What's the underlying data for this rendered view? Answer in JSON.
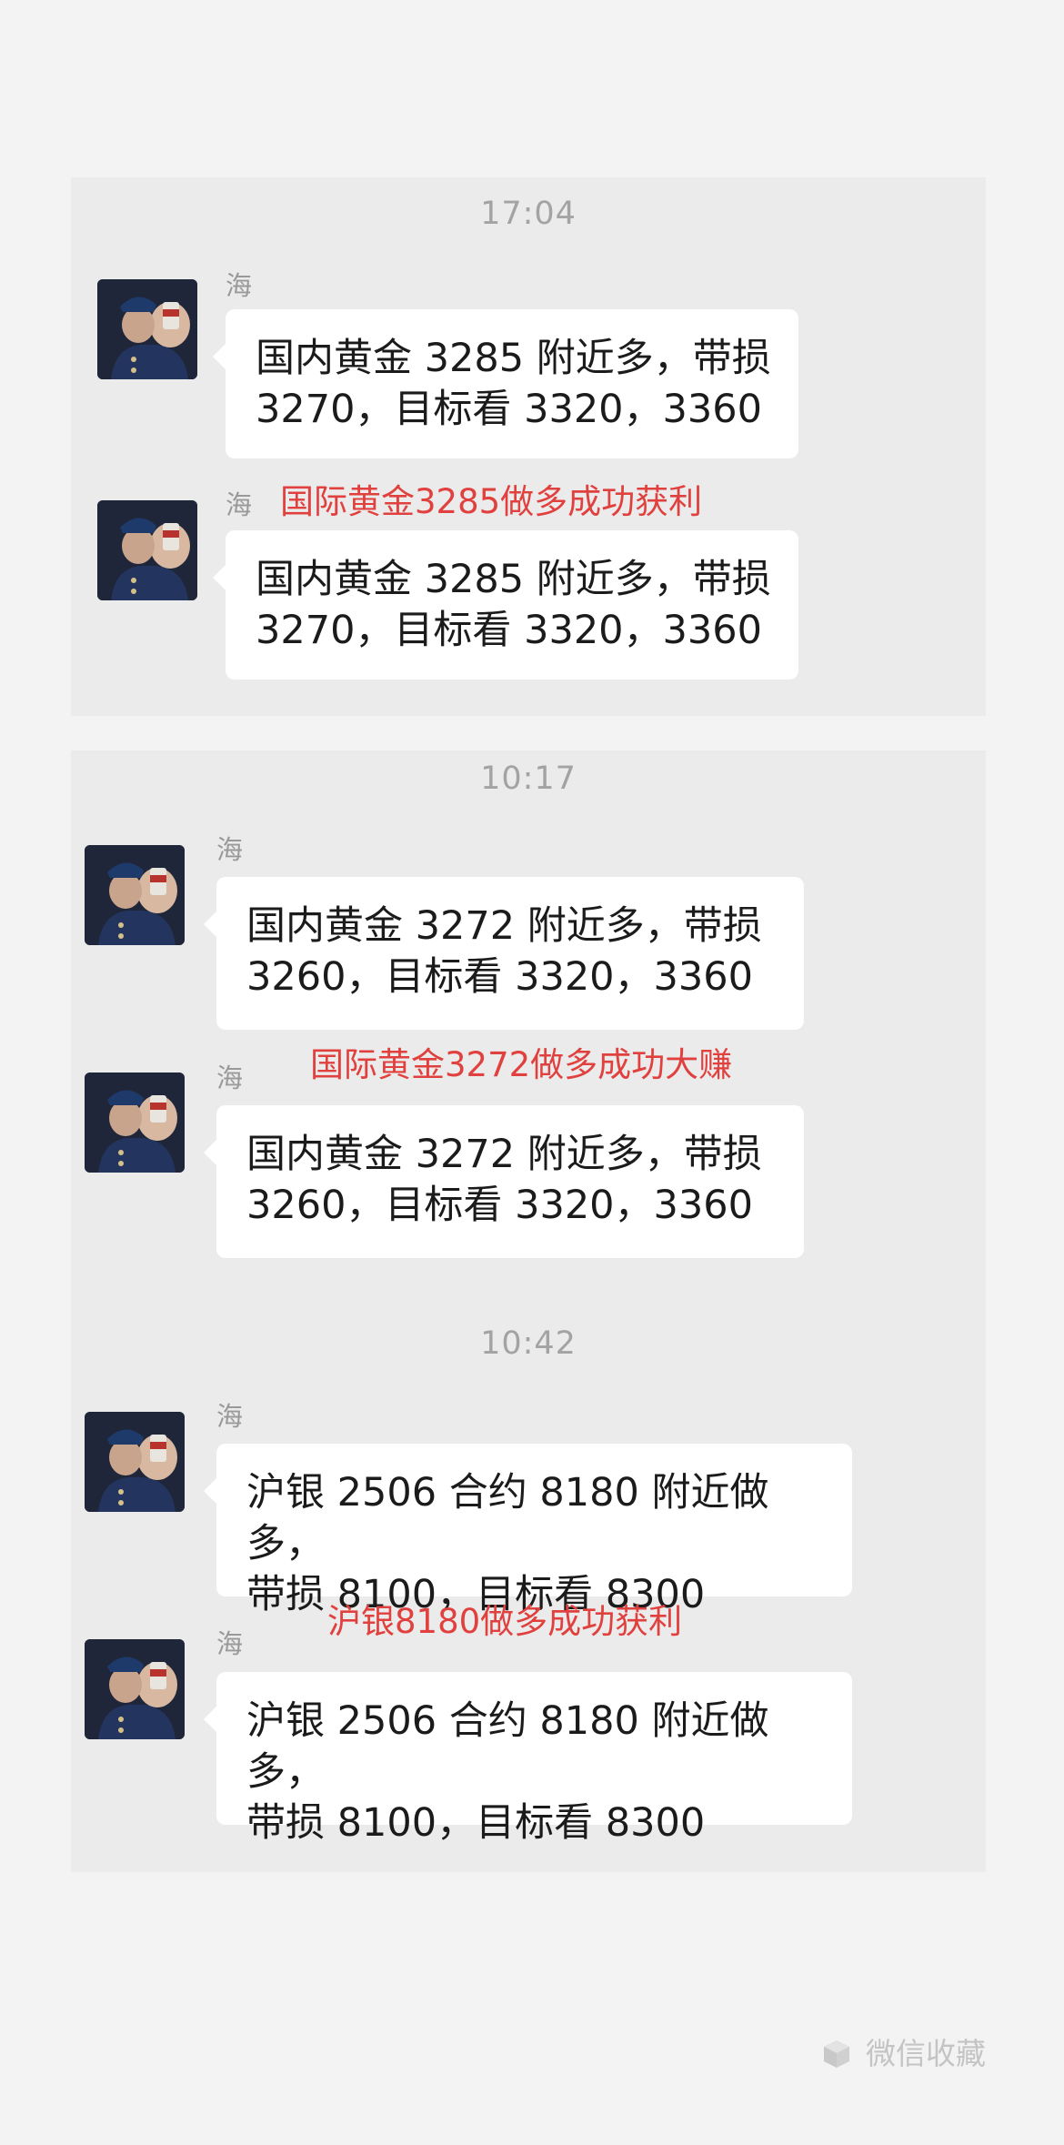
{
  "cards": [
    {
      "time": "17:04",
      "messages": [
        {
          "sender": "海",
          "text": "国内黄金 3285 附近多，带损\n3270，目标看 3320，3360"
        },
        {
          "sender": "海",
          "text": "国内黄金 3285 附近多，带损\n3270，目标看 3320，3360",
          "note": "国际黄金3285做多成功获利"
        }
      ]
    },
    {
      "time": "10:17",
      "messages": [
        {
          "sender": "海",
          "text": "国内黄金 3272 附近多，带损\n3260，目标看 3320，3360"
        },
        {
          "sender": "海",
          "text": "国内黄金 3272 附近多，带损\n3260，目标看 3320，3360",
          "note": "国际黄金3272做多成功大赚"
        }
      ],
      "time2": "10:42",
      "messages2": [
        {
          "sender": "海",
          "text": "沪银 2506 合约 8180 附近做多，\n带损 8100，目标看 8300"
        },
        {
          "sender": "海",
          "text": "沪银 2506 合约 8180 附近做多，\n带损 8100，目标看 8300",
          "note": "沪银8180做多成功获利"
        }
      ]
    }
  ],
  "footer": {
    "label": "微信收藏",
    "icon": "cube-icon"
  },
  "colors": {
    "note": "#e0413e",
    "background": "#f3f3f3",
    "card": "#ebebeb"
  }
}
